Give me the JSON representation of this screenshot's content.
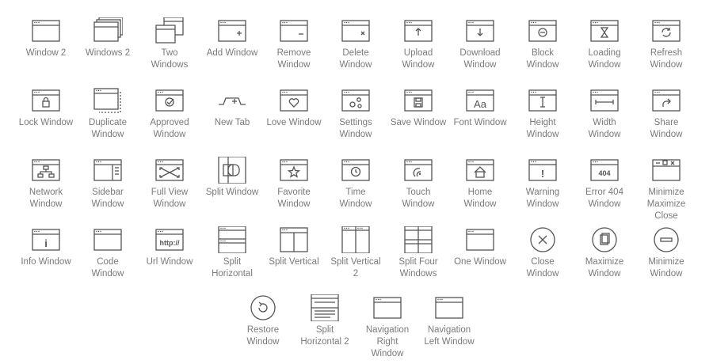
{
  "icons": [
    {
      "label": "Window 2",
      "icon": "window-icon"
    },
    {
      "label": "Windows 2",
      "icon": "stacked-windows-icon"
    },
    {
      "label": "Two\nWindows",
      "icon": "two-windows-icon"
    },
    {
      "label": "Add Window",
      "icon": "add-window-icon"
    },
    {
      "label": "Remove\nWindow",
      "icon": "remove-window-icon"
    },
    {
      "label": "Delete\nWindow",
      "icon": "delete-window-icon"
    },
    {
      "label": "Upload\nWindow",
      "icon": "upload-window-icon"
    },
    {
      "label": "Download\nWindow",
      "icon": "download-window-icon"
    },
    {
      "label": "Block\nWindow",
      "icon": "block-window-icon"
    },
    {
      "label": "Loading\nWindow",
      "icon": "loading-window-icon"
    },
    {
      "label": "Refresh\nWindow",
      "icon": "refresh-window-icon"
    },
    {
      "label": "Lock Window",
      "icon": "lock-window-icon"
    },
    {
      "label": "Duplicate\nWindow",
      "icon": "duplicate-window-icon"
    },
    {
      "label": "Approved\nWindow",
      "icon": "approved-window-icon"
    },
    {
      "label": "New Tab",
      "icon": "new-tab-icon"
    },
    {
      "label": "Love Window",
      "icon": "love-window-icon"
    },
    {
      "label": "Settings\nWindow",
      "icon": "settings-window-icon"
    },
    {
      "label": "Save Window",
      "icon": "save-window-icon"
    },
    {
      "label": "Font Window",
      "icon": "font-window-icon",
      "text": "Aa"
    },
    {
      "label": "Height\nWindow",
      "icon": "height-window-icon"
    },
    {
      "label": "Width\nWindow",
      "icon": "width-window-icon"
    },
    {
      "label": "Share\nWindow",
      "icon": "share-window-icon"
    },
    {
      "label": "Network\nWindow",
      "icon": "network-window-icon"
    },
    {
      "label": "Sidebar\nWindow",
      "icon": "sidebar-window-icon"
    },
    {
      "label": "Full View\nWindow",
      "icon": "full-view-window-icon"
    },
    {
      "label": "Split Window",
      "icon": "split-window-icon"
    },
    {
      "label": "Favorite\nWindow",
      "icon": "favorite-window-icon"
    },
    {
      "label": "Time\nWindow",
      "icon": "time-window-icon"
    },
    {
      "label": "Touch\nWindow",
      "icon": "touch-window-icon"
    },
    {
      "label": "Home\nWindow",
      "icon": "home-window-icon"
    },
    {
      "label": "Warning\nWindow",
      "icon": "warning-window-icon",
      "text": "!"
    },
    {
      "label": "Error 404\nWindow",
      "icon": "error-404-window-icon",
      "text": "404"
    },
    {
      "label": "Minimize\nMaximize\nClose",
      "icon": "minimize-maximize-close-icon"
    },
    {
      "label": "Info Window",
      "icon": "info-window-icon",
      "text": "i"
    },
    {
      "label": "Code\nWindow",
      "icon": "code-window-icon",
      "text": "</>"
    },
    {
      "label": "Url Window",
      "icon": "url-window-icon",
      "text": "http://"
    },
    {
      "label": "Split\nHorizontal",
      "icon": "split-horizontal-icon"
    },
    {
      "label": "Split Vertical",
      "icon": "split-vertical-icon"
    },
    {
      "label": "Split Vertical\n2",
      "icon": "split-vertical-2-icon"
    },
    {
      "label": "Split Four\nWindows",
      "icon": "split-four-windows-icon"
    },
    {
      "label": "One Window",
      "icon": "one-window-icon"
    },
    {
      "label": "Close\nWindow",
      "icon": "close-window-icon"
    },
    {
      "label": "Maximize\nWindow",
      "icon": "maximize-window-icon"
    },
    {
      "label": "Minimize\nWindow",
      "icon": "minimize-window-icon"
    },
    {
      "label": "Restore\nWindow",
      "icon": "restore-window-icon"
    },
    {
      "label": "Split\nHorizontal 2",
      "icon": "split-horizontal-2-icon"
    },
    {
      "label": "Navigation\nRight\nWindow",
      "icon": "navigation-right-window-icon"
    },
    {
      "label": "Navigation\nLeft Window",
      "icon": "navigation-left-window-icon"
    }
  ]
}
